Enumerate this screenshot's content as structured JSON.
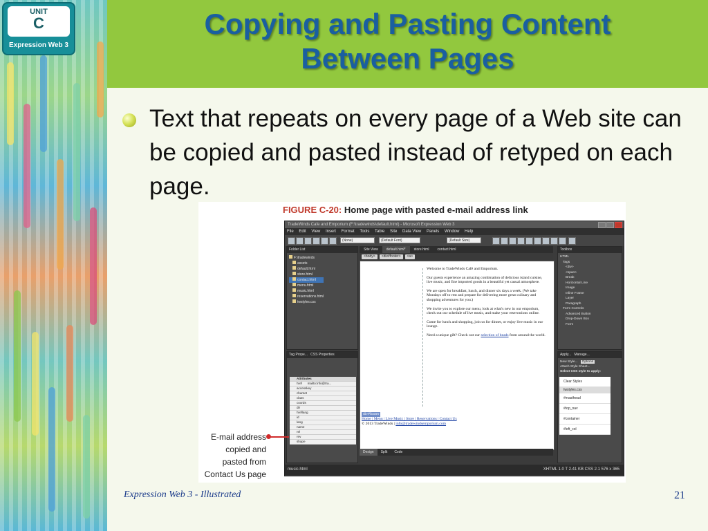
{
  "badge": {
    "unit_label": "UNIT",
    "unit_letter": "C",
    "product": "Expression Web 3"
  },
  "title": {
    "line1": "Copying and Pasting Content",
    "line2": "Between Pages"
  },
  "bullet": {
    "text": "Text that repeats on every page of a Web site can be copied and pasted instead of retyped on each page."
  },
  "figure": {
    "caption_label": "FIGURE C-20:",
    "caption_text": "Home page with pasted e-mail address link",
    "callout": [
      "E-mail address",
      "copied and",
      "pasted from",
      "Contact Us page"
    ],
    "app": {
      "window_title": "TradeWinds Cafe and Emporium (F:\\tradewinds\\default.html) - Microsoft Expression Web 3",
      "menus": [
        "File",
        "Edit",
        "View",
        "Insert",
        "Format",
        "Tools",
        "Table",
        "Site",
        "Data View",
        "Panels",
        "Window",
        "Help"
      ],
      "style_select": "(None)",
      "font_select": "(Default Font)",
      "size_select": "(Default Size)",
      "folder_list": {
        "title": "Folder List",
        "items": [
          "F:\\tradewinds",
          "assets",
          "default.html",
          "store.html",
          "contact.html",
          "menu.html",
          "music.html",
          "reservations.html",
          "twstyles.css"
        ]
      },
      "tabs": [
        "Site View",
        "default.html*",
        "store.html",
        "contact.html"
      ],
      "breadcrumb": [
        "<body>",
        "<div#footer>",
        "<a>"
      ],
      "editor": {
        "paragraphs": [
          "Welcome to TradeWinds Café and Emporium.",
          "Our guests experience an amazing combination of delicious island cuisine, live music, and fine imported goods in a beautiful yet casual atmosphere.",
          "We are open for breakfast, lunch, and dinner six days a week. (We take Mondays off to rest and prepare for delivering more great culinary and shopping adventures for you.)",
          "We invite you to explore our menu, look at what's new in our emporium, check out our schedule of live music, and make your reservations online.",
          "Come for lunch and shopping, join us for dinner, or enjoy live music in our lounge."
        ],
        "gift_text": "Need a unique gift? Check out our",
        "gift_link": "selection of beads",
        "gift_tail": "from around the world.",
        "footer_tag": "div#footer",
        "footer_links": "Home | Menu | Live Music | Store | Reservations | Contact Us",
        "copyright": "© 2013 TradeWinds |",
        "email_link": "info@tradewindsemporium.com"
      },
      "view_tabs": [
        "Design",
        "Split",
        "Code"
      ],
      "tag_panel": {
        "tabs": [
          "Tag Prope...",
          "CSS Properties"
        ],
        "header": "Attributes",
        "attributes": [
          {
            "name": "href",
            "value": "mailto:info@tra..."
          },
          {
            "name": "accesskey",
            "value": ""
          },
          {
            "name": "charset",
            "value": ""
          },
          {
            "name": "class",
            "value": ""
          },
          {
            "name": "coords",
            "value": ""
          },
          {
            "name": "dir",
            "value": ""
          },
          {
            "name": "hreflang",
            "value": ""
          },
          {
            "name": "id",
            "value": ""
          },
          {
            "name": "lang",
            "value": ""
          },
          {
            "name": "name",
            "value": ""
          },
          {
            "name": "rel",
            "value": ""
          },
          {
            "name": "rev",
            "value": ""
          },
          {
            "name": "shape",
            "value": ""
          }
        ]
      },
      "toolbox": {
        "title": "Toolbox",
        "items": [
          "HTML",
          "Tags",
          "<div>",
          "<span>",
          "Break",
          "Horizontal Line",
          "Image",
          "Inline Frame",
          "Layer",
          "Paragraph",
          "Form Controls",
          "Advanced Button",
          "Drop-Down Box",
          "Form"
        ]
      },
      "styles_panel": {
        "tabs": [
          "Apply...",
          "Manage..."
        ],
        "new_style": "New Style...",
        "options": "Options",
        "attach": "Attach Style Sheet...",
        "select_label": "Select CSS style to apply:",
        "items": [
          "Clear Styles",
          "twstyles.css",
          "#masthead",
          "#top_nav",
          "#container",
          "#left_col"
        ]
      },
      "status": {
        "left": "music.html",
        "right": "XHTML 1.0 T   2.41 KB   CSS 2.1   576 x 365"
      }
    }
  },
  "footer": {
    "course": "Expression Web 3 - Illustrated",
    "page": "21"
  }
}
